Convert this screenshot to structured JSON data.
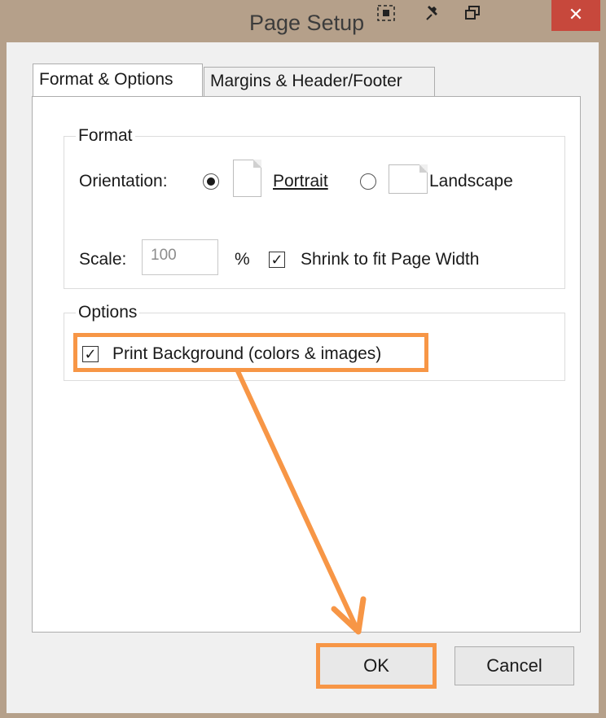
{
  "window": {
    "title": "Page Setup",
    "close_label": "✕"
  },
  "tabs": [
    {
      "label": "Format & Options",
      "active": true
    },
    {
      "label": "Margins & Header/Footer",
      "active": false
    }
  ],
  "format_group": {
    "label": "Format",
    "orientation_label": "Orientation:",
    "portrait_label": "Portrait",
    "landscape_label": "Landscape",
    "orientation_selected": "Portrait",
    "scale_label": "Scale:",
    "scale_value": "100",
    "percent_label": "%",
    "shrink_label": "Shrink to fit Page Width",
    "shrink_checked": true
  },
  "options_group": {
    "label": "Options",
    "print_background_label": "Print Background (colors & images)",
    "print_background_checked": true
  },
  "buttons": {
    "ok_label": "OK",
    "cancel_label": "Cancel"
  },
  "annotation_color": "#f79646"
}
